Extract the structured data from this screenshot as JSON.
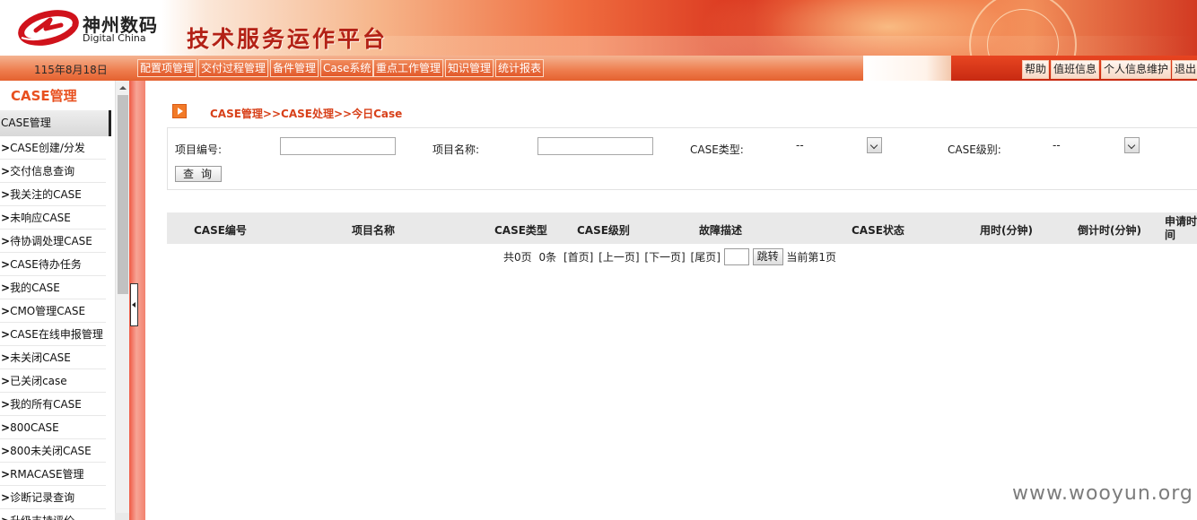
{
  "header": {
    "brand_cn": "神州数码",
    "brand_en": "Digital China",
    "platform_title": "技术服务运作平台"
  },
  "navbar": {
    "date": "115年8月18日",
    "menu": [
      "配置项管理",
      "交付过程管理",
      "备件管理",
      "Case系统",
      "重点工作管理",
      "知识管理",
      "统计报表"
    ],
    "utility": [
      "帮助",
      "值班信息",
      "个人信息维护",
      "退出"
    ]
  },
  "sidebar": {
    "title": "CASE管理",
    "section": "CASE管理",
    "items": [
      "CASE创建/分发",
      "交付信息查询",
      "我关注的CASE",
      "未响应CASE",
      "待协调处理CASE",
      "CASE待办任务",
      "我的CASE",
      "CMO管理CASE",
      "CASE在线申报管理",
      "未关闭CASE",
      "已关闭case",
      "我的所有CASE",
      "800CASE",
      "800未关闭CASE",
      "RMACASE管理",
      "诊断记录查询",
      "升级支持评价"
    ]
  },
  "main": {
    "breadcrumb": "CASE管理>>CASE处理>>今日Case",
    "search": {
      "project_no_label": "项目编号:",
      "project_no_value": "",
      "project_name_label": "项目名称:",
      "project_name_value": "",
      "case_type_label": "CASE类型:",
      "case_type_value": "--",
      "case_level_label": "CASE级别:",
      "case_level_value": "--",
      "query_button": "查询"
    },
    "table": {
      "columns": [
        "CASE编号",
        "项目名称",
        "CASE类型",
        "CASE级别",
        "故障描述",
        "CASE状态",
        "用时(分钟)",
        "倒计时(分钟)",
        "申请时间"
      ],
      "rows": []
    },
    "pager": {
      "total_pages": "共0页",
      "total_items": "0条",
      "first": "[首页]",
      "prev": "[上一页]",
      "next": "[下一页]",
      "last": "[尾页]",
      "page_input": "",
      "jump_button": "跳转",
      "current": "当前第1页"
    }
  },
  "watermark": "www.wooyun.org",
  "colors": {
    "accent_orange": "#e8501f",
    "breadcrumb_red": "#d8411a",
    "title_red": "#b32116",
    "nav_orange": "#ee7c4d"
  }
}
